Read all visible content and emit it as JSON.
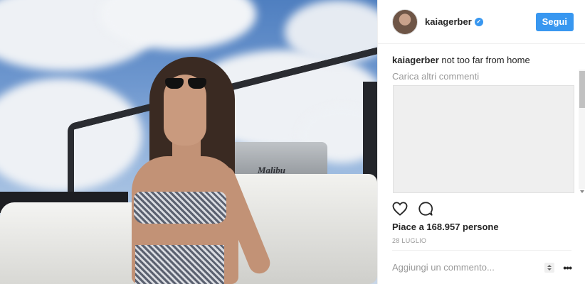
{
  "post": {
    "author": {
      "username": "kaiagerber",
      "verified_badge": "✓"
    },
    "follow_label": "Segui",
    "caption": {
      "username": "kaiagerber",
      "text": "not too far from home"
    },
    "load_more_label": "Carica altri commenti",
    "likes_label": "Piace a 168.957 persone",
    "date_label": "28 LUGLIO",
    "comment_input": {
      "placeholder": "Aggiungi un commento...",
      "value": ""
    },
    "more_label": "•••",
    "photo": {
      "boat_logo": "Malibu"
    },
    "icons": {
      "like": "heart-icon",
      "comment": "comment-bubble-icon",
      "sort": "sort-arrows-icon",
      "more": "more-options-icon"
    },
    "colors": {
      "accent": "#3897f0",
      "text": "#262626",
      "muted": "#999999",
      "border": "#efefef"
    }
  }
}
